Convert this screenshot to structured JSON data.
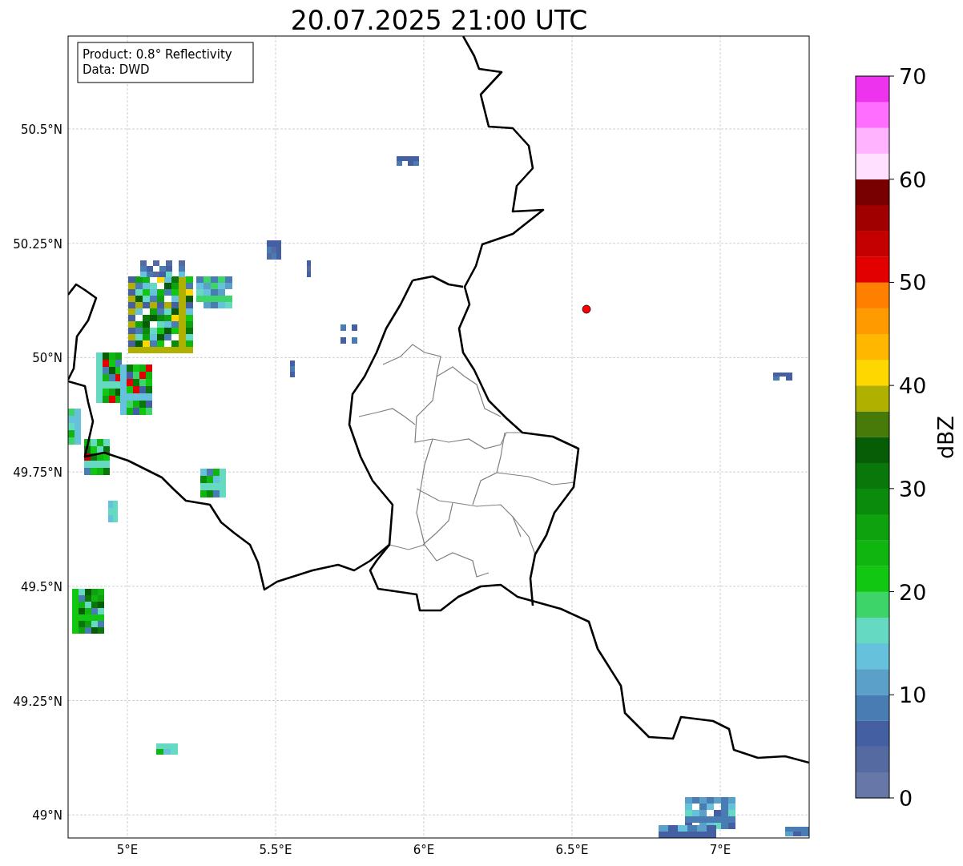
{
  "title": "20.07.2025 21:00 UTC",
  "map": {
    "info_box": [
      "Product: 0.8° Reflectivity",
      "Data: DWD"
    ],
    "lat_ticks": [
      "50.5°N",
      "50.25°N",
      "50°N",
      "49.75°N",
      "49.5°N",
      "49.25°N",
      "49°N"
    ],
    "lon_ticks": [
      "5°E",
      "5.5°E",
      "6°E",
      "6.5°E",
      "7°E"
    ],
    "markers": [
      {
        "kind": "point",
        "color": "#ff0000"
      }
    ]
  },
  "colorbar": {
    "label": "dBZ",
    "ticks": [
      "70",
      "60",
      "50",
      "40",
      "30",
      "20",
      "10",
      "0"
    ],
    "bands": [
      {
        "color": "#6677a8"
      },
      {
        "color": "#556aa0"
      },
      {
        "color": "#4560a2"
      },
      {
        "color": "#4a7cb4"
      },
      {
        "color": "#5ba0c8"
      },
      {
        "color": "#66c2dc"
      },
      {
        "color": "#66d9c2"
      },
      {
        "color": "#3dd46a"
      },
      {
        "color": "#12c712"
      },
      {
        "color": "#10b510"
      },
      {
        "color": "#0ea30e"
      },
      {
        "color": "#0b8b0b"
      },
      {
        "color": "#0a770a"
      },
      {
        "color": "#065d06"
      },
      {
        "color": "#487a0a"
      },
      {
        "color": "#b0b000"
      },
      {
        "color": "#ffd700"
      },
      {
        "color": "#ffb700"
      },
      {
        "color": "#ff9b00"
      },
      {
        "color": "#ff7f00"
      },
      {
        "color": "#e20000"
      },
      {
        "color": "#c40000"
      },
      {
        "color": "#a00000"
      },
      {
        "color": "#780000"
      },
      {
        "color": "#ffe0ff"
      },
      {
        "color": "#ffb3ff"
      },
      {
        "color": "#ff6eff"
      },
      {
        "color": "#ee33ee"
      }
    ]
  }
}
